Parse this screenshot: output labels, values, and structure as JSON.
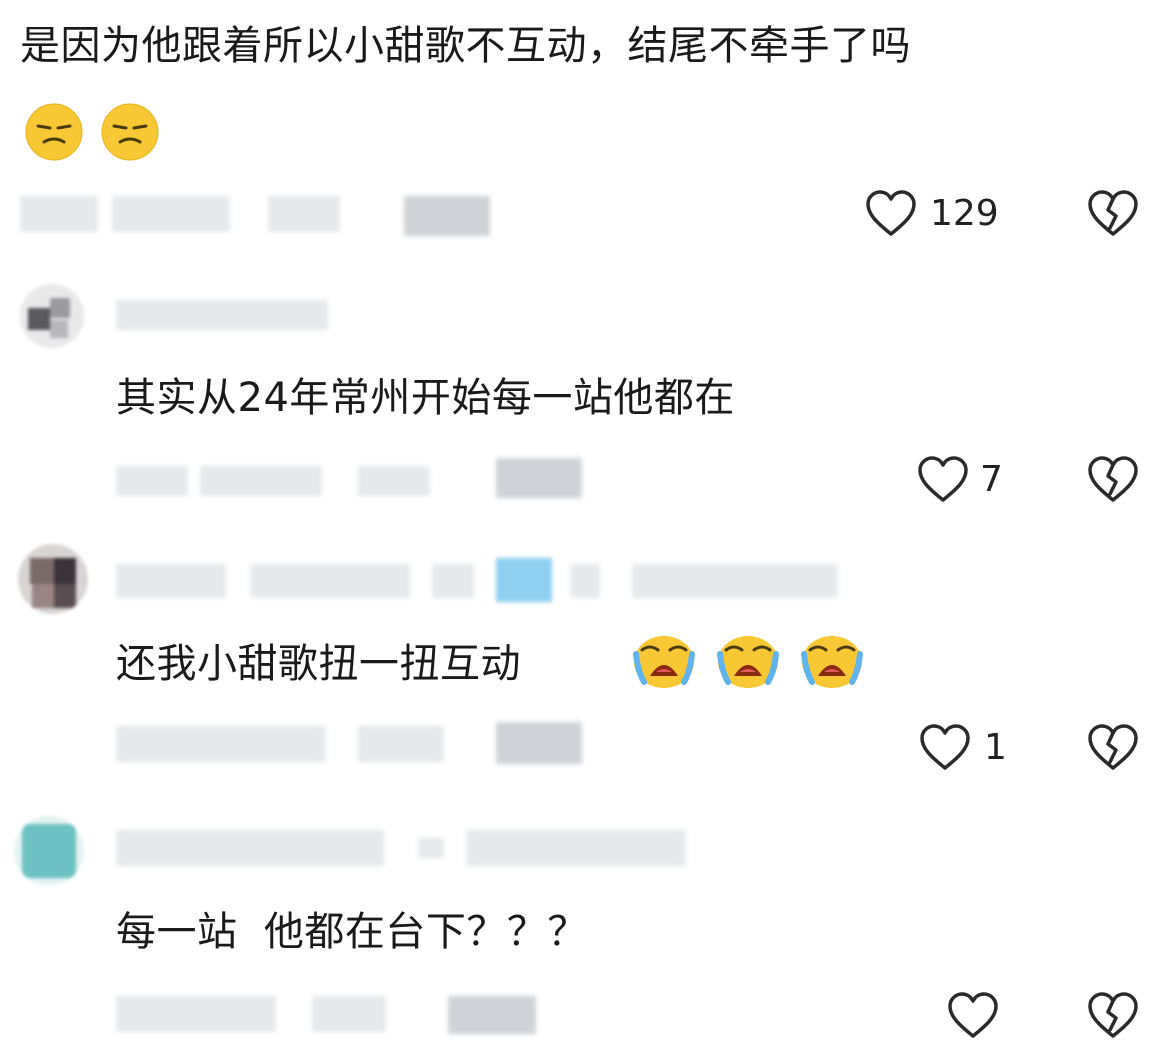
{
  "comments": [
    {
      "text": "是因为他跟着所以小甜歌不互动，结尾不牵手了吗",
      "emojis": [
        "frowning-face-emoji",
        "frowning-face-emoji"
      ],
      "likes": "129"
    },
    {
      "text": "其实从24年常州开始每一站他都在",
      "likes": "7"
    },
    {
      "text": "还我小甜歌扭一扭互动",
      "emojis": [
        "loudly-crying-emoji",
        "loudly-crying-emoji",
        "loudly-crying-emoji"
      ],
      "likes": "1"
    },
    {
      "text": "每一站  他都在台下？？？",
      "likes": ""
    }
  ],
  "colors": {
    "text": "#1a1a1a",
    "emoji_yellow": "#f7c833",
    "blur_gray": "#e6e8ea"
  }
}
